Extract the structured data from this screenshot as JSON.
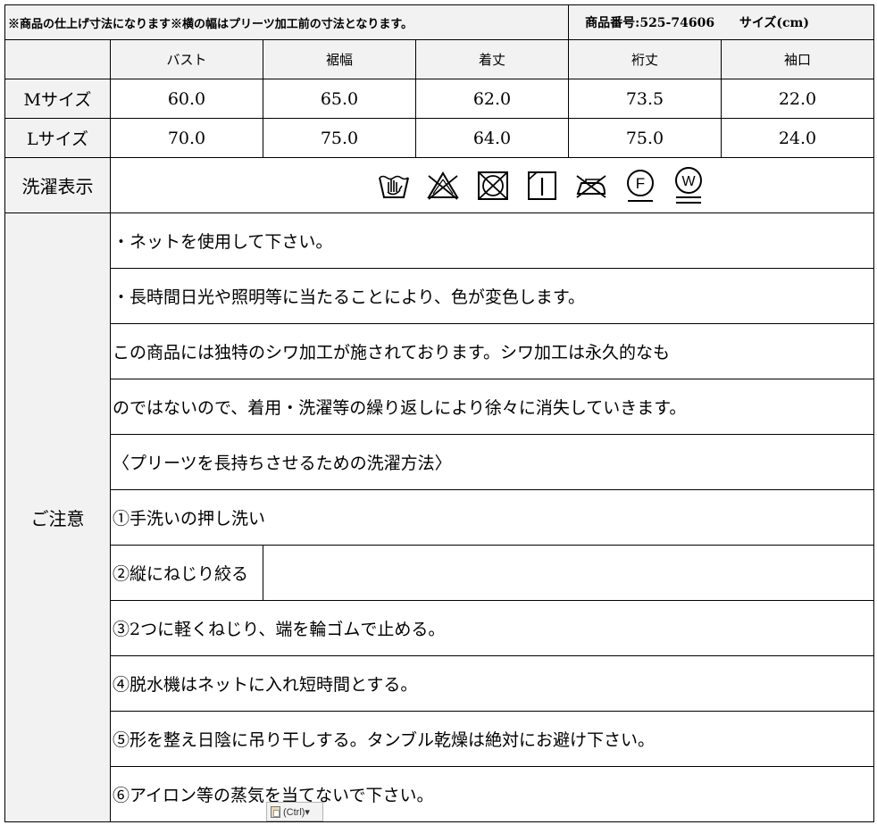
{
  "header": {
    "note": "※商品の仕上げ寸法になります※横の幅はプリーツ加工前の寸法となります。",
    "product_no": "商品番号:525-74606",
    "unit": "サイズ(cm)"
  },
  "columns": [
    "バスト",
    "裾幅",
    "着丈",
    "裄丈",
    "袖口"
  ],
  "sizes": [
    {
      "label": "Mサイズ",
      "values": [
        "60.0",
        "65.0",
        "62.0",
        "73.5",
        "22.0"
      ]
    },
    {
      "label": "Lサイズ",
      "values": [
        "70.0",
        "75.0",
        "64.0",
        "75.0",
        "24.0"
      ]
    }
  ],
  "care": {
    "label": "洗濯表示",
    "icons": [
      "hand-wash-icon",
      "no-bleach-icon",
      "no-tumble-dry-icon",
      "line-dry-shade-icon",
      "no-iron-icon",
      "dry-clean-f-icon",
      "wet-clean-w-icon"
    ]
  },
  "notes": {
    "label": "ご注意",
    "lines": [
      "・ネットを使用して下さい。",
      "・長時間日光や照明等に当たることにより、色が変色します。",
      "この商品には独特のシワ加工が施されております。シワ加工は永久的なも",
      "のではないので、着用・洗濯等の繰り返しにより徐々に消失していきます。",
      "〈プリーツを長持ちさせるための洗濯方法〉",
      "①手洗いの押し洗い",
      "②縦にねじり絞る",
      "③2つに軽くねじり、端を輪ゴムで止める。",
      "④脱水機はネットに入れ短時間とする。",
      "⑤形を整え日陰に吊り干しする。タンブル乾燥は絶対にお避け下さい。",
      "⑥アイロン等の蒸気を当てないで下さい。"
    ]
  },
  "paste_chip": {
    "label": "(Ctrl)▾"
  }
}
